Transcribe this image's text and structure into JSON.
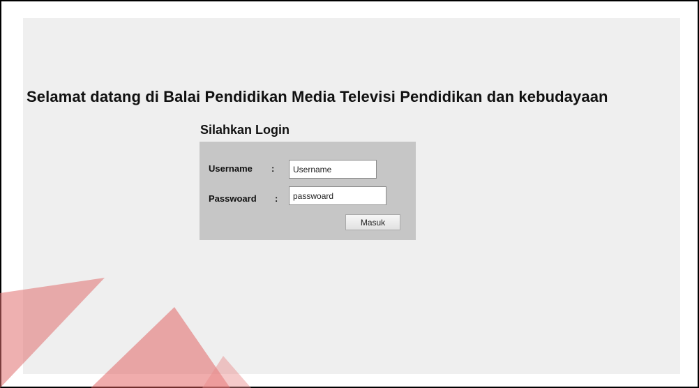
{
  "page": {
    "welcome": "Selamat datang di Balai Pendidikan Media Televisi Pendidikan dan kebudayaan"
  },
  "login": {
    "title": "Silahkan Login",
    "username_label": "Username",
    "password_label": "Passwoard",
    "separator": ":",
    "username_value": "Username",
    "password_value": "passwoard",
    "submit_label": "Masuk"
  },
  "colors": {
    "panel": "#efefef",
    "login_box": "#c6c6c6",
    "watermark": "#d9373a"
  },
  "icons": {
    "watermark": "red-triangle-logo-watermark"
  }
}
